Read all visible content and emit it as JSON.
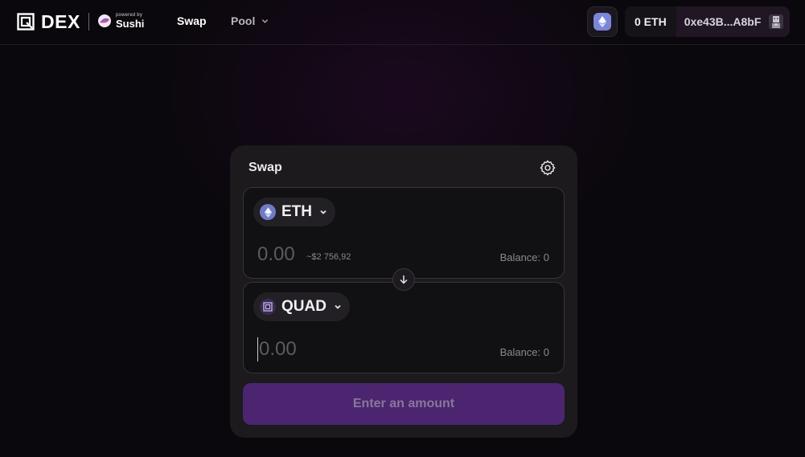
{
  "header": {
    "logo_text": "DEX",
    "powered_by_label": "powered by",
    "powered_by_brand": "Sushi",
    "nav": {
      "swap_label": "Swap",
      "pool_label": "Pool"
    },
    "network_icon": "ethereum-icon",
    "account": {
      "balance": "0 ETH",
      "address": "0xe43B...A8bF"
    }
  },
  "swap_card": {
    "title": "Swap",
    "settings_icon": "gear-icon",
    "from": {
      "token": "ETH",
      "amount_placeholder": "0.00",
      "usd_value": "~$2 756,92",
      "balance": "Balance: 0"
    },
    "to": {
      "token": "QUAD",
      "amount_placeholder": "0.00",
      "balance": "Balance: 0"
    },
    "switch_icon": "arrow-down-icon",
    "submit_label": "Enter an amount"
  },
  "colors": {
    "background": "#0b080d",
    "card": "#1c1a1d",
    "panel": "#111012",
    "accent_button": "#4b2570",
    "eth_blue": "#6f7bc7"
  }
}
